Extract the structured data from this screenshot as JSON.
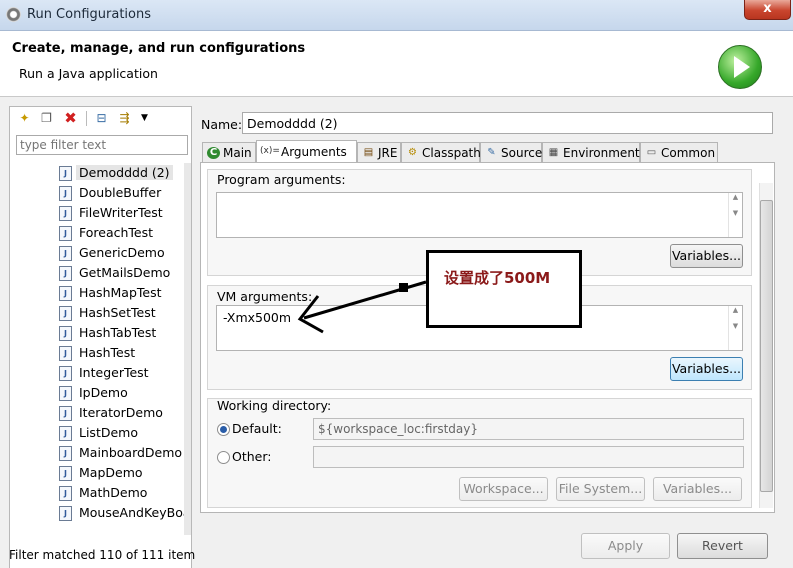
{
  "window": {
    "title": "Run Configurations",
    "close_label": "x"
  },
  "header": {
    "title": "Create, manage, and run configurations",
    "subtitle": "Run a Java application"
  },
  "left": {
    "filter_placeholder": "type filter text",
    "items": [
      "Demodddd (2)",
      "DoubleBuffer",
      "FileWriterTest",
      "ForeachTest",
      "GenericDemo",
      "GetMailsDemo",
      "HashMapTest",
      "HashSetTest",
      "HashTabTest",
      "HashTest",
      "IntegerTest",
      "IpDemo",
      "IteratorDemo",
      "ListDemo",
      "MainboardDemo",
      "MapDemo",
      "MathDemo",
      "MouseAndKeyBoa"
    ],
    "selected_index": 0,
    "filter_matched": "Filter matched 110 of 111 item"
  },
  "config": {
    "name_label": "Name:",
    "name_value": "Demodddd (2)"
  },
  "tabs": [
    {
      "label": "Main",
      "icon": "main-tab-icon"
    },
    {
      "label": "Arguments",
      "icon": "arguments-tab-icon",
      "prefix": "(x)="
    },
    {
      "label": "JRE",
      "icon": "jre-tab-icon"
    },
    {
      "label": "Classpath",
      "icon": "classpath-tab-icon"
    },
    {
      "label": "Source",
      "icon": "source-tab-icon"
    },
    {
      "label": "Environment",
      "icon": "environment-tab-icon"
    },
    {
      "label": "Common",
      "icon": "common-tab-icon"
    }
  ],
  "arguments": {
    "program_label": "Program arguments:",
    "program_value": "",
    "variables_label": "Variables...",
    "vm_label": "VM arguments:",
    "vm_value": "-Xmx500m",
    "vm_variables_label": "Variables..."
  },
  "working_dir": {
    "label": "Working directory:",
    "default_label": "Default:",
    "default_value": "${workspace_loc:firstday}",
    "other_label": "Other:",
    "other_value": "",
    "workspace_btn": "Workspace...",
    "filesystem_btn": "File System...",
    "variables_btn": "Variables..."
  },
  "footer": {
    "apply": "Apply",
    "revert": "Revert"
  },
  "annotation": {
    "text": "设置成了500M"
  },
  "colors": {
    "annotation_text": "#8b1a1a",
    "run_icon": "#36a82a"
  }
}
